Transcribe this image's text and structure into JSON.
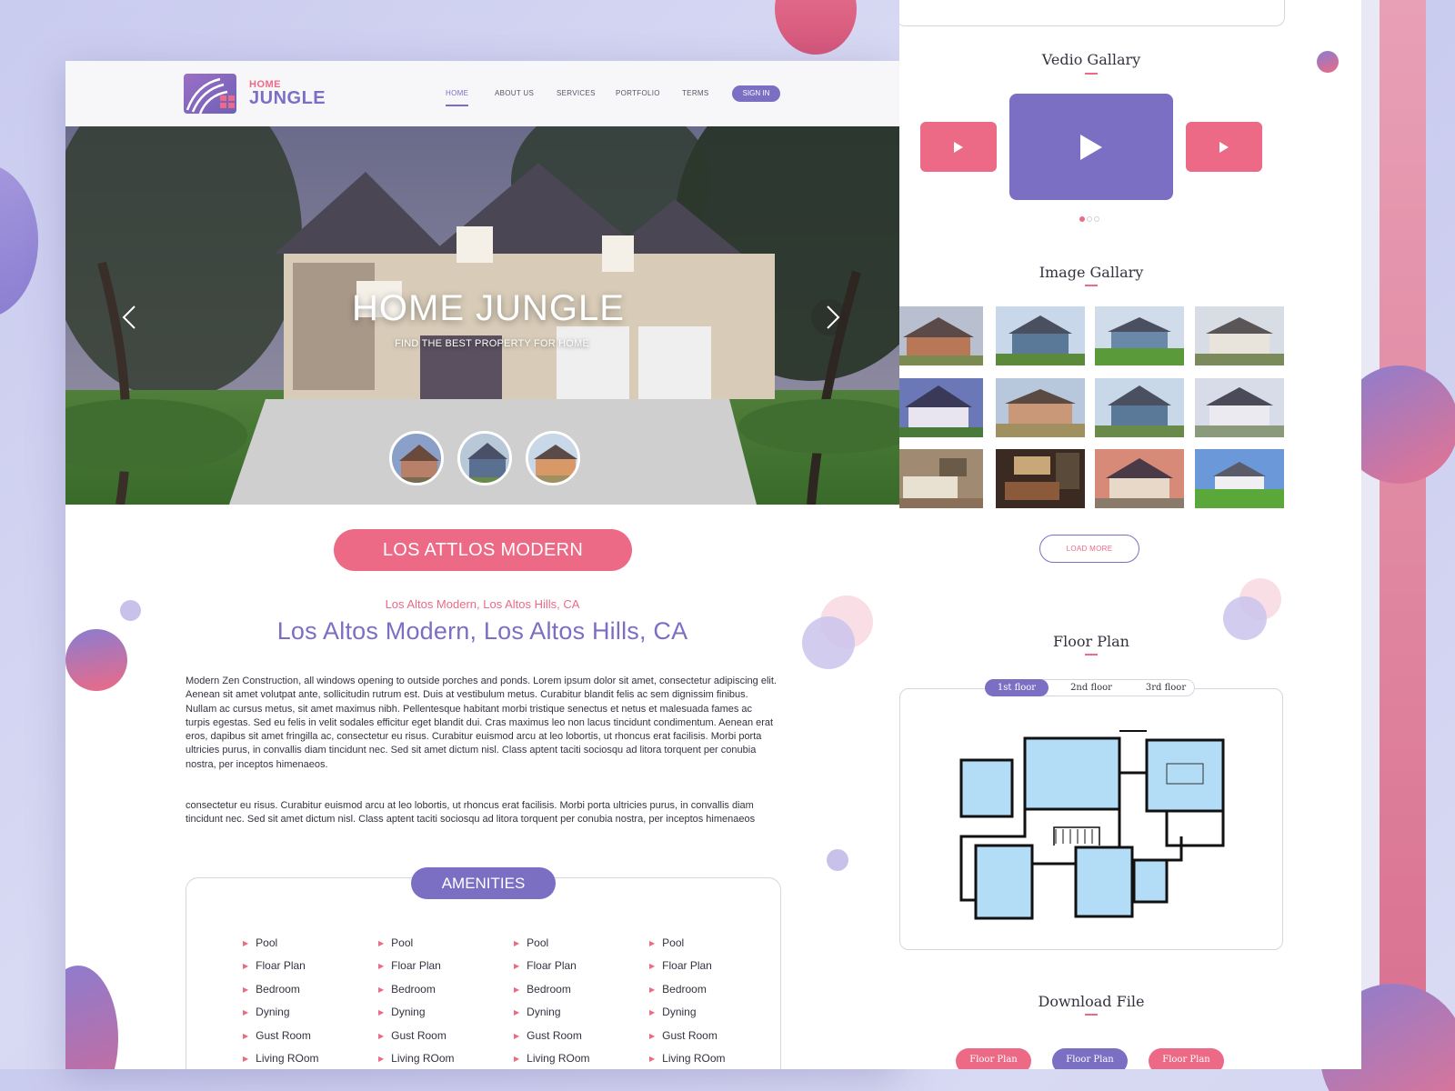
{
  "colors": {
    "accent_purple": "#7b6fc4",
    "accent_pink": "#ec6a86",
    "text": "#333340"
  },
  "logo": {
    "small": "HOME",
    "large": "JUNGLE"
  },
  "nav": {
    "items": [
      {
        "label": "HOME",
        "active": true
      },
      {
        "label": "ABOUT US",
        "active": false
      },
      {
        "label": "SERVICES",
        "active": false
      },
      {
        "label": "PORTFOLIO",
        "active": false
      },
      {
        "label": "TERMS",
        "active": false
      }
    ],
    "sign_in": "SIGN IN"
  },
  "hero": {
    "title": "HOME JUNGLE",
    "subtitle": "FIND THE BEST PROPERTY FOR HOME",
    "prev_icon": "chevron-left-icon",
    "next_icon": "chevron-right-icon"
  },
  "listing": {
    "pill_title": "LOS ATTLOS MODERN",
    "small_heading": "Los Altos Modern, Los Altos Hills, CA",
    "heading": "Los Altos Modern, Los Altos Hills, CA",
    "paragraph1": "Modern Zen Construction,  all windows opening to outside porches and ponds. Lorem ipsum dolor sit amet, consectetur adipiscing elit. Aenean sit amet volutpat ante, sollicitudin rutrum est. Duis at vestibulum metus. Curabitur blandit felis ac sem dignissim finibus. Nullam ac cursus metus, sit amet maximus nibh. Pellentesque habitant morbi tristique senectus et netus et malesuada fames ac turpis egestas. Sed eu felis in velit sodales efficitur eget blandit dui. Cras maximus leo non lacus tincidunt condimentum. Aenean erat eros, dapibus sit amet fringilla ac, consectetur eu risus. Curabitur euismod arcu at leo lobortis, ut rhoncus erat facilisis. Morbi porta ultricies purus, in convallis diam tincidunt nec. Sed sit amet dictum nisl. Class aptent taciti sociosqu ad litora torquent per conubia nostra, per inceptos himenaeos.",
    "paragraph2": "consectetur eu risus. Curabitur euismod arcu at leo lobortis, ut rhoncus erat facilisis. Morbi porta ultricies purus, in convallis diam tincidunt nec. Sed sit amet dictum nisl. Class aptent taciti sociosqu ad litora torquent per conubia nostra, per inceptos himenaeos"
  },
  "amenities": {
    "title": "AMENITIES",
    "columns": [
      [
        "Pool",
        "Floar Plan",
        "Bedroom",
        "Dyning",
        "Gust Room",
        "Living ROom"
      ],
      [
        "Pool",
        "Floar Plan",
        "Bedroom",
        "Dyning",
        "Gust Room",
        "Living ROom"
      ],
      [
        "Pool",
        "Floar Plan",
        "Bedroom",
        "Dyning",
        "Gust Room",
        "Living ROom"
      ],
      [
        "Pool",
        "Floar Plan",
        "Bedroom",
        "Dyning",
        "Gust Room",
        "Living ROom"
      ]
    ]
  },
  "video_gallery": {
    "title": "Vedio Gallary",
    "play_icon": "play-icon"
  },
  "image_gallery": {
    "title": "Image Gallary",
    "load_more": "LOAD MORE"
  },
  "floor_plan": {
    "title": "Floor Plan",
    "tabs": [
      {
        "label": "1st floor",
        "active": true
      },
      {
        "label": "2nd floor",
        "active": false
      },
      {
        "label": "3rd floor",
        "active": false
      }
    ]
  },
  "download": {
    "title": "Download File",
    "buttons": [
      "Floor Plan",
      "Floor Plan",
      "Floor Plan"
    ]
  }
}
